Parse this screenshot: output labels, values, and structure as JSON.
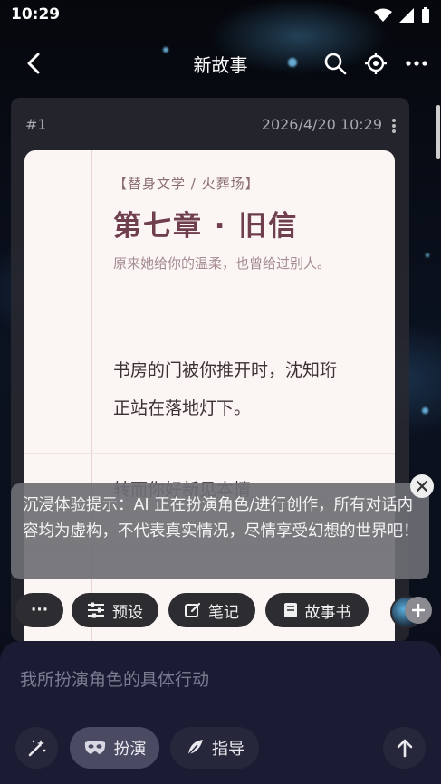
{
  "status_bar": {
    "time": "10:29"
  },
  "app_bar": {
    "title": "新故事"
  },
  "entry": {
    "number": "#1",
    "datetime": "2026/4/20 10:29",
    "tag": "【替身文学 / 火葬场】",
    "chapter_title": "第七章 · 旧信",
    "subtitle": "原来她给你的温柔，也曾给过别人。",
    "paragraph_1": "书房的门被你推开时，沈知珩正站在落地灯下。",
    "paragraph_2": "转而你好新见本情"
  },
  "notice": {
    "text": "沉浸体验提示：AI 正在扮演角色/进行创作，所有对话内容均为虚构，不代表真实情况，尽情享受幻想的世界吧！"
  },
  "toolbar": {
    "more_label": "···",
    "preset_label": "预设",
    "notes_label": "笔记",
    "storybook_label": "故事书"
  },
  "composer": {
    "placeholder": "我所扮演角色的具体行动",
    "roleplay_label": "扮演",
    "guide_label": "指导"
  },
  "colors": {
    "accent_chapter": "#6f3f4d",
    "paper": "#fbf5f3",
    "composer_bg": "#1b1c33"
  }
}
